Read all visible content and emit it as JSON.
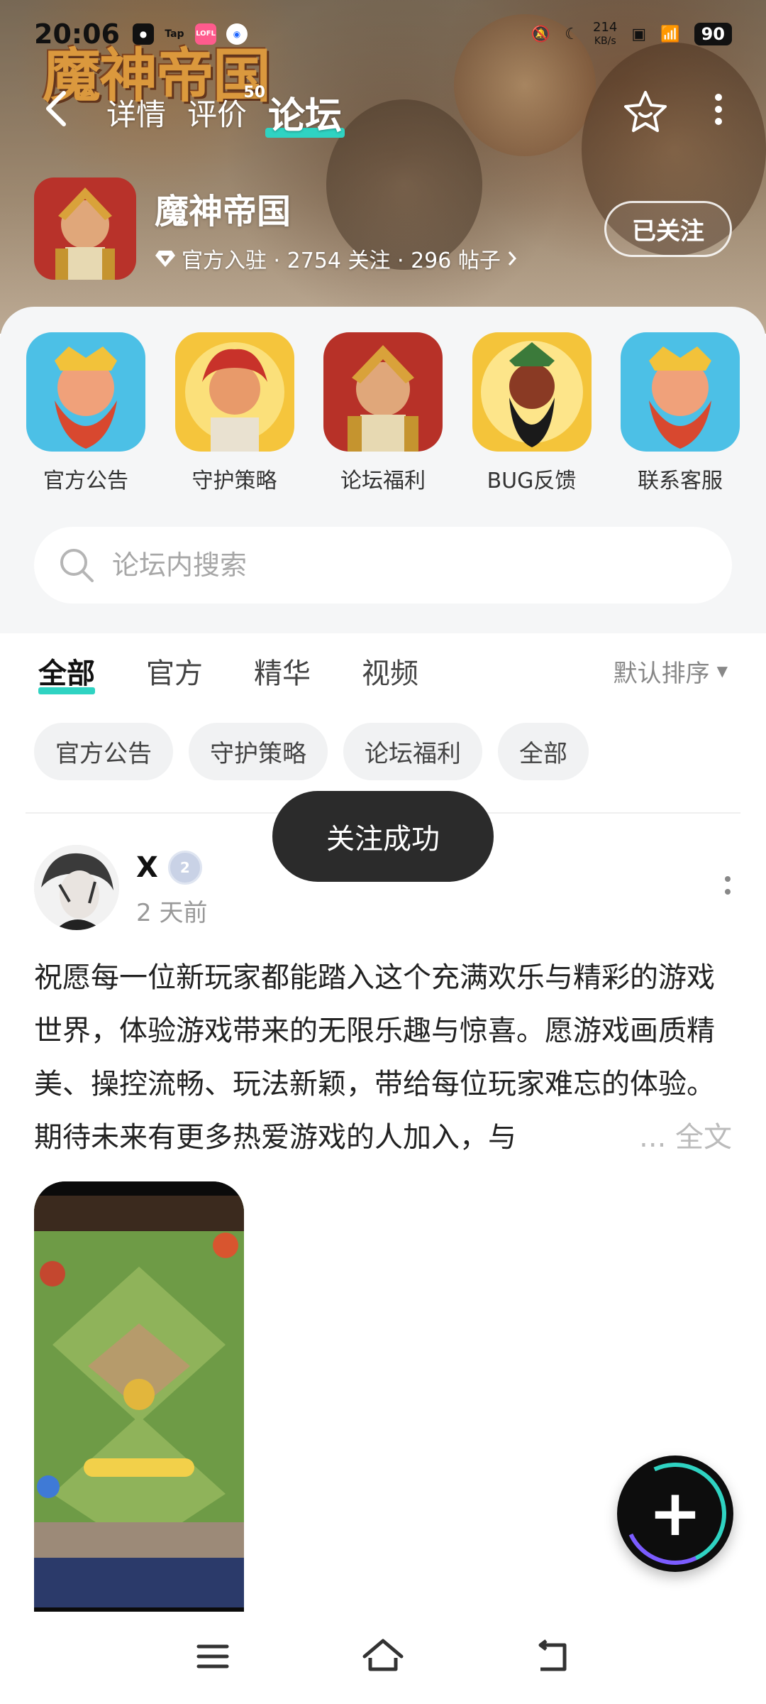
{
  "status_bar": {
    "time": "20:06",
    "app_icons": [
      {
        "icon": "qq-icon",
        "text": "",
        "color": "#111111"
      },
      {
        "icon": "taptap-icon",
        "text": "Tap",
        "color": "#1c1c1c"
      },
      {
        "icon": "lofter-icon",
        "text": "LOFL",
        "color": "#ff5b8d"
      },
      {
        "icon": "app-icon",
        "text": "",
        "color": "#1e66ff"
      }
    ],
    "net_speed_value": "214",
    "net_speed_unit": "KB/s",
    "battery": "90"
  },
  "top_nav": {
    "tabs": [
      {
        "label": "详情"
      },
      {
        "label": "评价",
        "badge": "50"
      },
      {
        "label": "论坛"
      }
    ],
    "active_tab": "论坛"
  },
  "game": {
    "name": "魔神帝国",
    "stats": "官方入驻 · 2754 关注 · 296 帖子",
    "follow_label": "已关注",
    "logo_text": "魔神帝国"
  },
  "shortcuts": [
    {
      "label": "官方公告",
      "icon": "dwarf-king-icon"
    },
    {
      "label": "守护策略",
      "icon": "warrior-icon"
    },
    {
      "label": "论坛福利",
      "icon": "knight-icon"
    },
    {
      "label": "BUG反馈",
      "icon": "guan-yu-icon"
    },
    {
      "label": "联系客服",
      "icon": "dwarf-king-icon"
    }
  ],
  "search": {
    "placeholder": "论坛内搜索"
  },
  "filter_tabs": [
    {
      "label": "全部",
      "active": true
    },
    {
      "label": "官方"
    },
    {
      "label": "精华"
    },
    {
      "label": "视频"
    }
  ],
  "sort_label": "默认排序",
  "chips": [
    "官方公告",
    "守护策略",
    "论坛福利",
    "全部"
  ],
  "toast": "关注成功",
  "post": {
    "author": "X",
    "level_badge": "2",
    "time": "2 天前",
    "text": "祝愿每一位新玩家都能踏入这个充满欢乐与精彩的游戏世界，体验游戏带来的无限乐趣与惊喜。愿游戏画质精美、操控流畅、玩法新颖，带给每位玩家难忘的体验。期待未来有更多热爱游戏的人加入，与",
    "read_more": "... 全文"
  },
  "colors": {
    "accent": "#2fd3c2",
    "toast_bg": "#2b2b2b"
  }
}
